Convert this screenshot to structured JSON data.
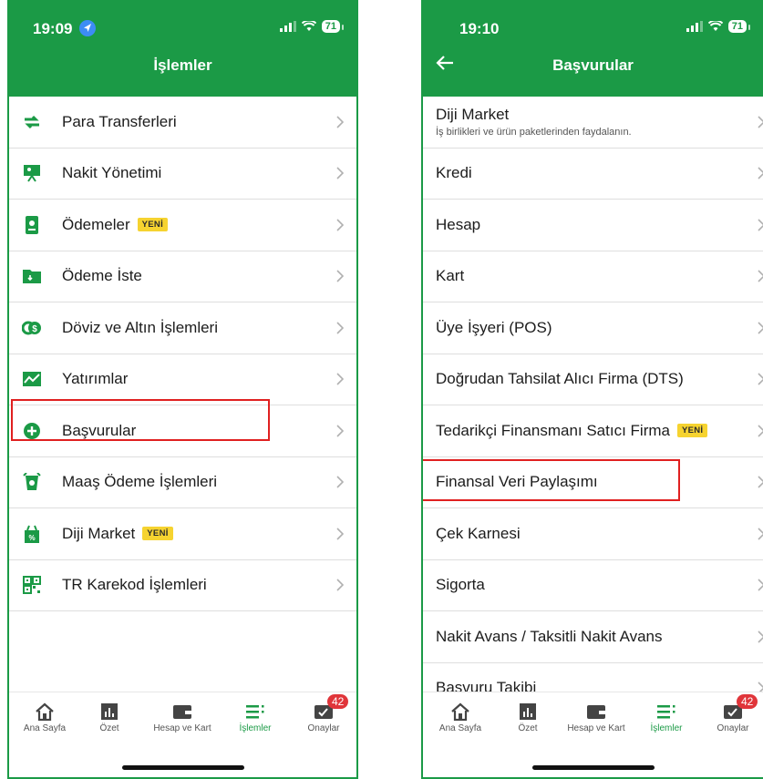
{
  "left": {
    "status": {
      "time": "19:09",
      "battery": "71"
    },
    "title": "İşlemler",
    "items": [
      {
        "label": "Para Transferleri",
        "icon": "transfer-arrows-icon"
      },
      {
        "label": "Nakit Yönetimi",
        "icon": "presentation-board-icon"
      },
      {
        "label": "Ödemeler",
        "icon": "payment-receipt-icon",
        "badge": "YENİ"
      },
      {
        "label": "Ödeme İste",
        "icon": "wallet-request-icon"
      },
      {
        "label": "Döviz ve Altın İşlemleri",
        "icon": "currency-coins-icon"
      },
      {
        "label": "Yatırımlar",
        "icon": "chart-line-icon"
      },
      {
        "label": "Başvurular",
        "icon": "plus-circle-icon"
      },
      {
        "label": "Maaş Ödeme İşlemleri",
        "icon": "salary-bag-icon"
      },
      {
        "label": "Diji Market",
        "icon": "discount-bag-icon",
        "badge": "YENİ"
      },
      {
        "label": "TR Karekod İşlemleri",
        "icon": "qr-code-icon"
      }
    ]
  },
  "right": {
    "status": {
      "time": "19:10",
      "battery": "71"
    },
    "title": "Başvurular",
    "items": [
      {
        "label": "Diji Market",
        "sub": "İş birlikleri ve ürün paketlerinden faydalanın."
      },
      {
        "label": "Kredi"
      },
      {
        "label": "Hesap"
      },
      {
        "label": "Kart"
      },
      {
        "label": "Üye İşyeri (POS)"
      },
      {
        "label": "Doğrudan Tahsilat Alıcı Firma (DTS)"
      },
      {
        "label": "Tedarikçi Finansmanı Satıcı Firma",
        "badge": "YENİ"
      },
      {
        "label": "Finansal Veri Paylaşımı"
      },
      {
        "label": "Çek Karnesi"
      },
      {
        "label": "Sigorta"
      },
      {
        "label": "Nakit Avans / Taksitli Nakit Avans"
      },
      {
        "label": "Başvuru Takibi"
      }
    ]
  },
  "tabs": [
    {
      "label": "Ana Sayfa",
      "icon": "home-icon"
    },
    {
      "label": "Özet",
      "icon": "bar-chart-icon"
    },
    {
      "label": "Hesap ve Kart",
      "icon": "wallet-icon"
    },
    {
      "label": "İşlemler",
      "icon": "transactions-list-icon",
      "active": true
    },
    {
      "label": "Onaylar",
      "icon": "approval-icon",
      "badge": "42"
    }
  ],
  "colors": {
    "brand_green": "#1b9a46",
    "highlight_red": "#e02020",
    "badge_yellow": "#f6d330",
    "badge_red": "#e0353a"
  }
}
